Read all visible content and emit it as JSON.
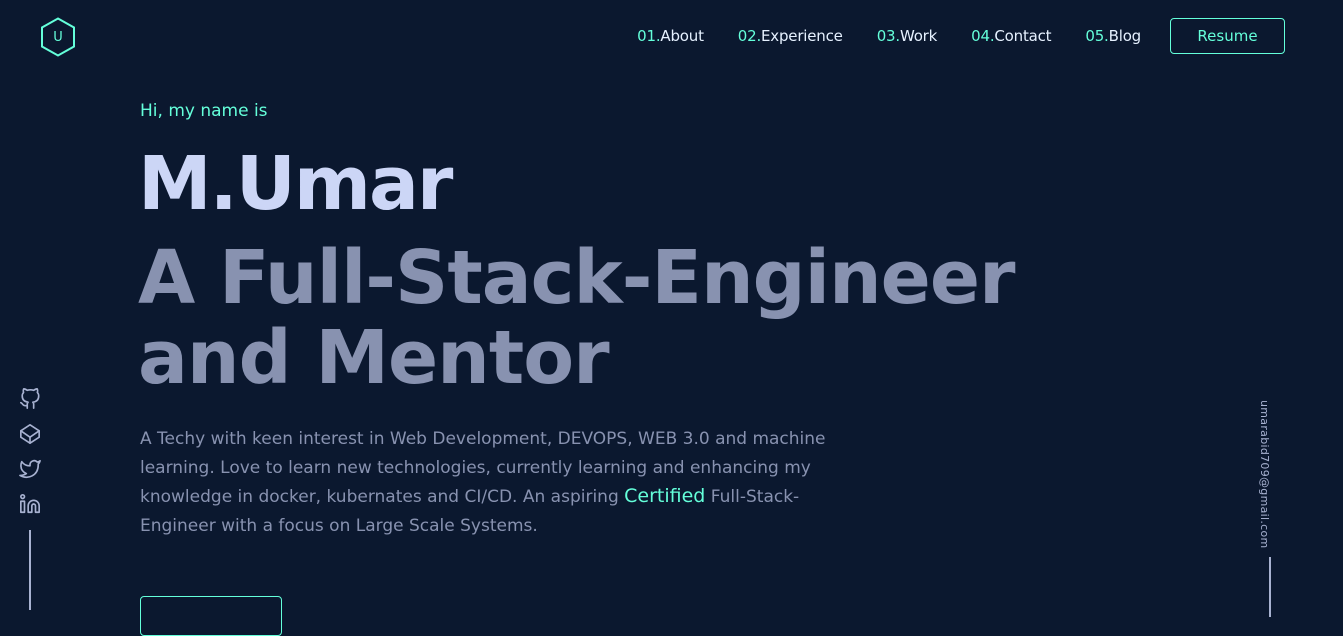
{
  "logo": {
    "letter": "U"
  },
  "nav": {
    "items": [
      {
        "num": "01.",
        "label": "About"
      },
      {
        "num": "02.",
        "label": "Experience"
      },
      {
        "num": "03.",
        "label": "Work"
      },
      {
        "num": "04.",
        "label": "Contact"
      },
      {
        "num": "05.",
        "label": "Blog"
      }
    ],
    "resume": "Resume"
  },
  "hero": {
    "greeting": "Hi, my name is",
    "name": "M.Umar",
    "tagline_line1": "A Full-Stack-Engineer",
    "tagline_line2": "and Mentor",
    "bio_before": "A Techy with keen interest in Web Development, DEVOPS, WEB 3.0 and machine learning. Love to learn new technologies, currently learning and enhancing my knowledge in docker, kubernates and CI/CD. An aspiring ",
    "bio_highlight": "Certified",
    "bio_after": " Full-Stack-Engineer with a focus on Large Scale Systems."
  },
  "social": {
    "icons": [
      "github-icon",
      "codepen-icon",
      "twitter-icon",
      "linkedin-icon"
    ]
  },
  "email": "umarabid709@gmail.com",
  "colors": {
    "background": "#0b182f",
    "accent": "#64ffda",
    "heading": "#ccd6f6",
    "text": "#8892b0"
  }
}
